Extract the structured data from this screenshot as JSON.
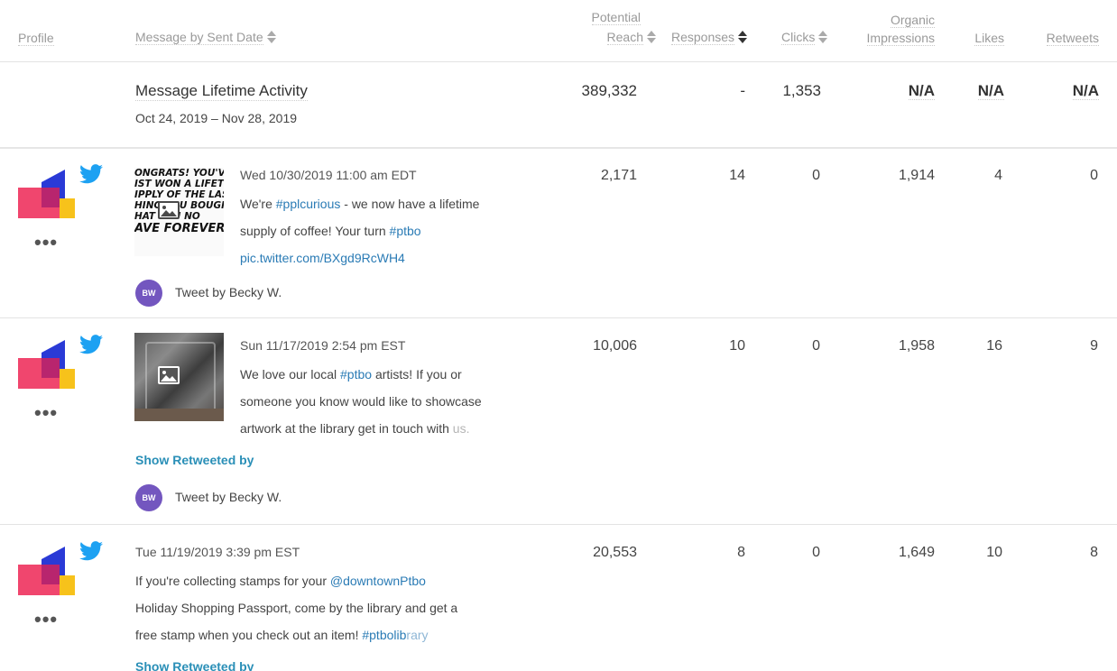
{
  "columns": {
    "profile": "Profile",
    "message": "Message by Sent Date",
    "reach_line1": "Potential",
    "reach_line2": "Reach",
    "responses": "Responses",
    "clicks": "Clicks",
    "impressions_line1": "Organic",
    "impressions_line2": "Impressions",
    "likes": "Likes",
    "retweets": "Retweets"
  },
  "summary": {
    "title": "Message Lifetime Activity",
    "dates": "Oct 24, 2019 – Nov 28, 2019",
    "reach": "389,332",
    "responses": "-",
    "clicks": "1,353",
    "impressions": "N/A",
    "likes": "N/A",
    "retweets": "N/A"
  },
  "rows": [
    {
      "date": "Wed 10/30/2019 11:00 am EDT",
      "line1_pre": "We're ",
      "line1_tag": "#pplcurious",
      "line1_post": " - we now have a lifetime",
      "line2_pre": "supply of coffee! Your turn ",
      "line2_tag": "#ptbo",
      "line3_link": "pic.twitter.com/BXgd9RcWH4",
      "thumb_text": [
        "ONGRATS! YOU'V",
        "IST WON A LIFETI",
        "IPPLY OF THE LAS",
        "HING YOU BOUGH",
        "HAT YOU NO",
        "AVE FOREVER"
      ],
      "author_initials": "BW",
      "author": "Tweet by Becky W.",
      "reach": "2,171",
      "responses": "14",
      "clicks": "0",
      "impressions": "1,914",
      "likes": "4",
      "retweets": "0"
    },
    {
      "date": "Sun 11/17/2019 2:54 pm EST",
      "line1_pre": "We love our local ",
      "line1_tag": "#ptbo",
      "line1_post": " artists! If you or",
      "line2": "someone you know would like to showcase",
      "line3_pre": "artwork at the library get in touch with ",
      "line3_fade": "us.",
      "show_retweeted": "Show Retweeted by",
      "author_initials": "BW",
      "author": "Tweet by Becky W.",
      "reach": "10,006",
      "responses": "10",
      "clicks": "0",
      "impressions": "1,958",
      "likes": "16",
      "retweets": "9"
    },
    {
      "date": "Tue 11/19/2019 3:39 pm EST",
      "line1_pre": "If you're collecting stamps for your ",
      "line1_tag": "@downtownPtbo",
      "line2": "Holiday Shopping Passport, come by the library and get a",
      "line3_pre": "free stamp when you check out an item! ",
      "line3_tag": "#ptbolib",
      "line3_fade": "rary",
      "show_retweeted": "Show Retweeted by",
      "reach": "20,553",
      "responses": "8",
      "clicks": "0",
      "impressions": "1,649",
      "likes": "10",
      "retweets": "8"
    }
  ],
  "colors": {
    "twitter_blue": "#1da1f2",
    "link_blue": "#2a7bb5",
    "show_retweeted": "#2a8fb7",
    "avatar": "#7356bf",
    "logo_pink": "#f0466e",
    "logo_blue": "#2a3ad6",
    "logo_yellow": "#f7c21b"
  }
}
